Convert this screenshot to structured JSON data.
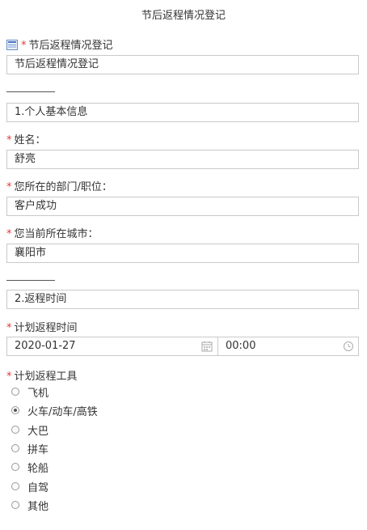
{
  "page_title": "节后返程情况登记",
  "form_title": {
    "label": "节后返程情况登记",
    "value": "节后返程情况登记",
    "required_mark": "*"
  },
  "section1": {
    "title": "1.个人基本信息"
  },
  "name": {
    "label": "姓名：",
    "value": "舒亮",
    "required_mark": "*"
  },
  "dept": {
    "label": "您所在的部门/职位：",
    "value": "客户成功",
    "required_mark": "*"
  },
  "city": {
    "label": "您当前所在城市：",
    "value": "襄阳市",
    "required_mark": "*"
  },
  "section2": {
    "title": "2.返程时间"
  },
  "return_time": {
    "label": "计划返程时间",
    "date": "2020-01-27",
    "time": "00:00",
    "required_mark": "*"
  },
  "transport": {
    "label": "计划返程工具",
    "required_mark": "*",
    "selected": "火车/动车/高铁",
    "options": [
      "飞机",
      "火车/动车/高铁",
      "大巴",
      "拼车",
      "轮船",
      "自驾",
      "其他"
    ]
  },
  "icons": {
    "title": "document-icon",
    "date": "calendar-icon",
    "time": "clock-icon"
  },
  "colors": {
    "required": "#e53935",
    "border": "#c9c9c9",
    "text": "#333333"
  }
}
